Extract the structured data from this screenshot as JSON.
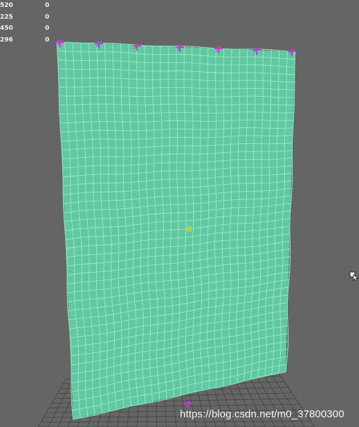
{
  "hud": {
    "rows": [
      {
        "label": "520",
        "value": "0"
      },
      {
        "label": "225",
        "value": "0"
      },
      {
        "label": "450",
        "value": "0"
      },
      {
        "label": "296",
        "value": "0"
      }
    ]
  },
  "watermark": "https://blog.csdn.net/m0_37800300",
  "colors": {
    "background": "#656565",
    "cloth": "#63c8a2",
    "wire": "#8ff0c4",
    "constraint": "#c43ad0",
    "pivot": "#e8d800",
    "ground_grid": "#3e3e3e"
  },
  "icons": {
    "constraint": "pin-constraint-icon",
    "pivot": "pivot-icon",
    "cursor": "mouse-cursor-icon"
  }
}
